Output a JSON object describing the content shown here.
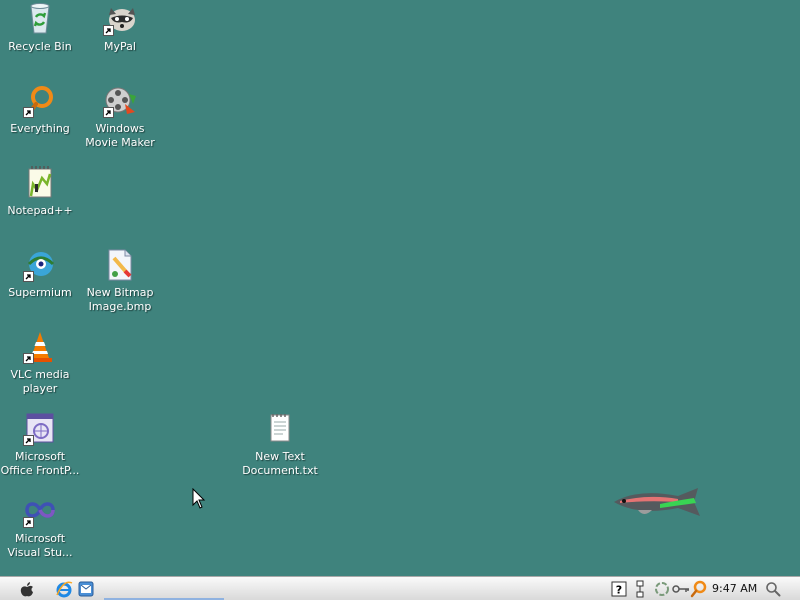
{
  "desktop": {
    "background_color": "#3f837d",
    "icons": [
      {
        "name": "recycle-bin",
        "label": "Recycle Bin",
        "icon": "recycle-bin-icon"
      },
      {
        "name": "mypal",
        "label": "MyPal",
        "icon": "raccoon-icon"
      },
      {
        "name": "everything",
        "label": "Everything",
        "icon": "orange-magnifier-icon"
      },
      {
        "name": "windows-movie-maker",
        "label": "Windows\nMovie Maker",
        "icon": "film-reel-icon"
      },
      {
        "name": "notepad-plus-plus",
        "label": "Notepad++",
        "icon": "notepad-icon"
      },
      {
        "name": "supermium",
        "label": "Supermium",
        "icon": "globe-eye-icon"
      },
      {
        "name": "new-bitmap-image",
        "label": "New Bitmap\nImage.bmp",
        "icon": "paint-icon"
      },
      {
        "name": "vlc-media-player",
        "label": "VLC media\nplayer",
        "icon": "traffic-cone-icon"
      },
      {
        "name": "microsoft-office-frontpage",
        "label": "Microsoft\nOffice FrontP...",
        "icon": "frontpage-icon"
      },
      {
        "name": "new-text-document",
        "label": "New Text\nDocument.txt",
        "icon": "text-file-icon"
      },
      {
        "name": "microsoft-visual-studio",
        "label": "Microsoft\nVisual Stu...",
        "icon": "infinity-icon"
      }
    ]
  },
  "taskbar": {
    "start_icon": "apple-logo-icon",
    "quick_launch": [
      "internet-explorer-icon",
      "outlook-express-icon"
    ],
    "tray_icons": [
      "help-icon",
      "network-icon",
      "recycle-tray-icon",
      "key-icon",
      "search-tray-icon"
    ],
    "clock": "9:47 AM",
    "search_icon": "magnifier-icon"
  }
}
